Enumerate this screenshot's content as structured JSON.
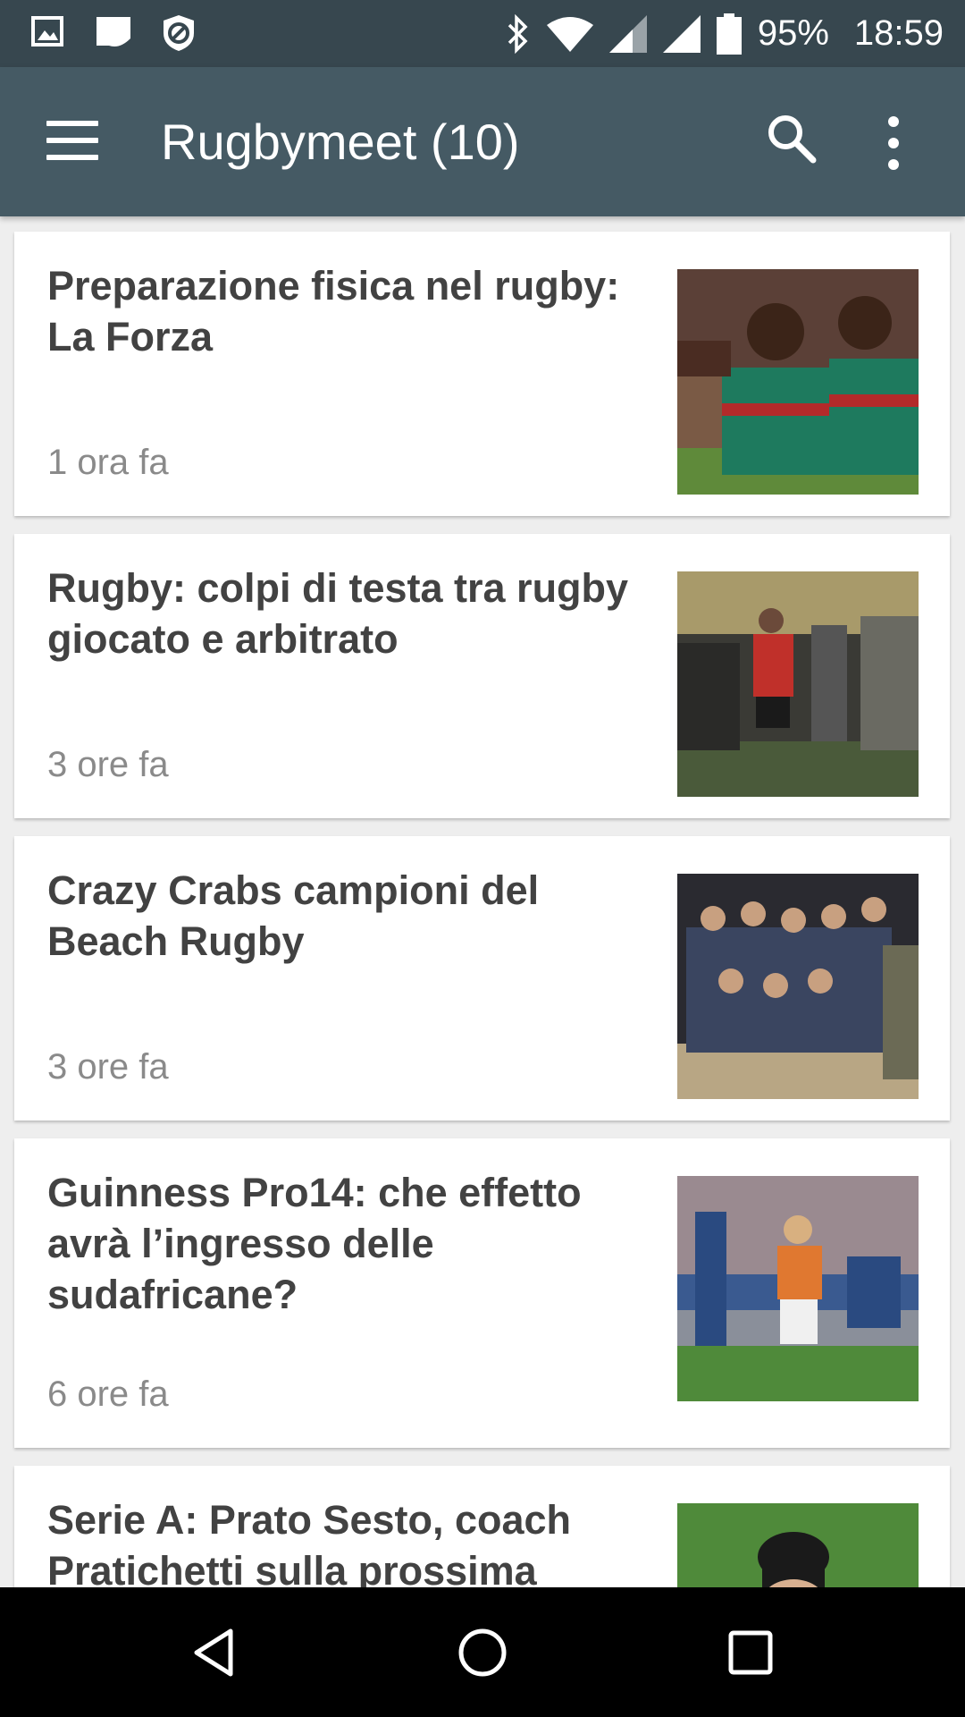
{
  "status_bar": {
    "battery_percent": "95%",
    "time": "18:59",
    "left_icons": [
      "gallery-icon",
      "message-icon",
      "blocked-shield-icon"
    ],
    "right_icons": [
      "bluetooth-icon",
      "wifi-icon",
      "signal-icon",
      "signal-icon",
      "battery-icon"
    ]
  },
  "app_bar": {
    "title": "Rugbymeet (10)",
    "background": "#455a64"
  },
  "articles": [
    {
      "title": "Preparazione fisica nel rugby: La Forza",
      "time": "1 ora fa",
      "image": "rugby-players-photo"
    },
    {
      "title": "Rugby: colpi di testa tra rugby giocato e arbitrato",
      "time": "3 ore fa",
      "image": "referee-photo"
    },
    {
      "title": "Crazy Crabs campioni del Beach Rugby",
      "time": "3 ore fa",
      "image": "team-celebration-photo"
    },
    {
      "title": "Guinness Pro14: che effetto avrà l’ingresso delle sudafricane?",
      "time": "6 ore fa",
      "image": "rugby-match-photo"
    },
    {
      "title": "Serie A: Prato Sesto, coach Pratichetti sulla prossima",
      "time": "",
      "image": "coach-photo"
    }
  ],
  "nav_bar": {
    "icons": [
      "back-icon",
      "home-icon",
      "recents-icon"
    ]
  }
}
